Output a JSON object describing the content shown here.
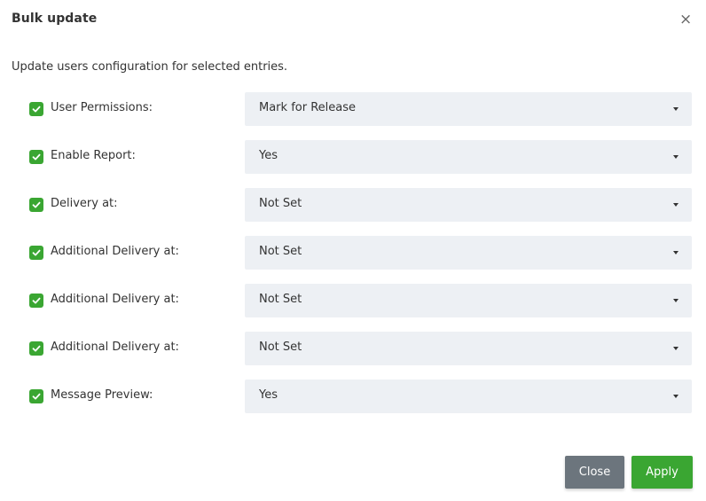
{
  "dialog": {
    "title": "Bulk update",
    "close_icon": "×",
    "description": "Update users configuration for selected entries."
  },
  "rows": [
    {
      "label": "User Permissions:",
      "value": "Mark for Release",
      "checked": true
    },
    {
      "label": "Enable Report:",
      "value": "Yes",
      "checked": true
    },
    {
      "label": "Delivery at:",
      "value": "Not Set",
      "checked": true
    },
    {
      "label": "Additional Delivery at:",
      "value": "Not Set",
      "checked": true
    },
    {
      "label": "Additional Delivery at:",
      "value": "Not Set",
      "checked": true
    },
    {
      "label": "Additional Delivery at:",
      "value": "Not Set",
      "checked": true
    },
    {
      "label": "Message Preview:",
      "value": "Yes",
      "checked": true
    }
  ],
  "footer": {
    "close_label": "Close",
    "apply_label": "Apply"
  },
  "colors": {
    "accent_green": "#3aa632",
    "secondary_gray": "#6c757d",
    "select_bg": "#edf0f4"
  },
  "icons": {
    "checkbox": "check-icon",
    "dropdown": "caret-down-icon",
    "close": "close-icon"
  }
}
